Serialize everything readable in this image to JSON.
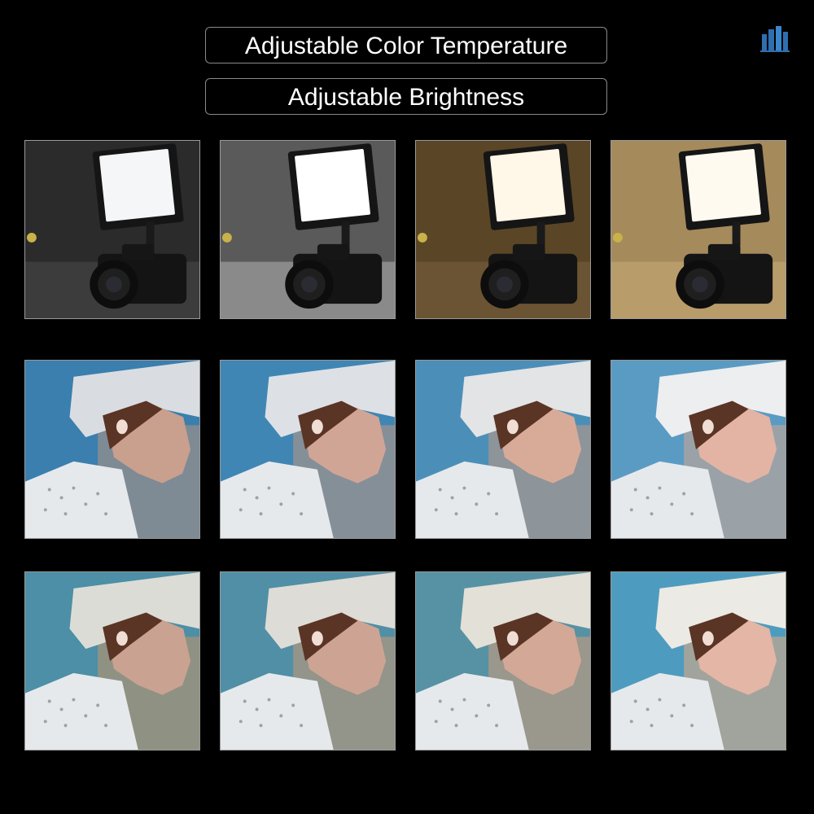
{
  "labels": {
    "color_temperature": "Adjustable Color Temperature",
    "brightness": "Adjustable Brightness"
  },
  "logo": {
    "icon": "building-logo-icon",
    "color": "#2f6fb0"
  },
  "rows": [
    {
      "subject": "led-panel-and-camera",
      "tiles": [
        {
          "bg": "#2b2b2b",
          "floor": "#3c3c3c",
          "panel": "#f4f6f8"
        },
        {
          "bg": "#5a5a5a",
          "floor": "#8a8a8a",
          "panel": "#ffffff"
        },
        {
          "bg": "#5a4627",
          "floor": "#6b5433",
          "panel": "#fff7e8"
        },
        {
          "bg": "#a58a5c",
          "floor": "#b89c6a",
          "panel": "#fffaf0"
        }
      ]
    },
    {
      "subject": "portrait-white-hat",
      "tiles": [
        {
          "bg": "#3a7fae",
          "wall": "#7e8a94",
          "skin": "#c99f8e",
          "hat": "#d9dde2"
        },
        {
          "bg": "#3f86b4",
          "wall": "#858f98",
          "skin": "#d1a595",
          "hat": "#dde1e5"
        },
        {
          "bg": "#4b8fb9",
          "wall": "#8d949a",
          "skin": "#d8ab98",
          "hat": "#e2e4e6"
        },
        {
          "bg": "#5a9bc4",
          "wall": "#9aa2a8",
          "skin": "#e3b4a4",
          "hat": "#eceef0"
        }
      ]
    },
    {
      "subject": "portrait-white-hat",
      "tiles": [
        {
          "bg": "#4c8fa6",
          "wall": "#8f9283",
          "skin": "#caa291",
          "hat": "#dcdcd6"
        },
        {
          "bg": "#508fa6",
          "wall": "#93948a",
          "skin": "#cda493",
          "hat": "#dedcd6"
        },
        {
          "bg": "#5692a4",
          "wall": "#9a978c",
          "skin": "#d3a896",
          "hat": "#e3e0d8"
        },
        {
          "bg": "#4d9cbf",
          "wall": "#a1a49c",
          "skin": "#e4b6a5",
          "hat": "#eceae4"
        }
      ]
    }
  ]
}
